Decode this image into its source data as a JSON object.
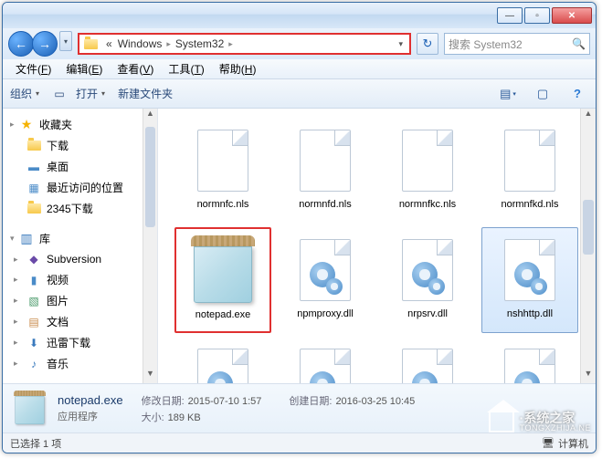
{
  "titlebar": {
    "min": "—",
    "max": "▫",
    "close": "✕"
  },
  "nav": {
    "back": "←",
    "forward": "→",
    "drop": "▾",
    "refresh": "↻"
  },
  "address": {
    "prefix": "«",
    "crumbs": [
      "Windows",
      "System32"
    ],
    "sep": "▸",
    "drop": "▾"
  },
  "search": {
    "placeholder": "搜索 System32",
    "icon": "🔍"
  },
  "menu": [
    {
      "label": "文件",
      "hot": "F"
    },
    {
      "label": "编辑",
      "hot": "E"
    },
    {
      "label": "查看",
      "hot": "V"
    },
    {
      "label": "工具",
      "hot": "T"
    },
    {
      "label": "帮助",
      "hot": "H"
    }
  ],
  "toolbar": {
    "organize": "组织",
    "open": "打开",
    "newfolder": "新建文件夹",
    "drop": "▾",
    "viewicon": "▤",
    "helpicon": "?"
  },
  "sidebar": {
    "favorites": {
      "label": "收藏夹",
      "items": [
        "下载",
        "桌面",
        "最近访问的位置",
        "2345下载"
      ]
    },
    "libraries": {
      "label": "库",
      "items": [
        "Subversion",
        "视频",
        "图片",
        "文档",
        "迅雷下载",
        "音乐"
      ]
    }
  },
  "files": [
    {
      "name": "normnfc.nls",
      "type": "doc",
      "selected": false,
      "highlighted": false
    },
    {
      "name": "normnfd.nls",
      "type": "doc",
      "selected": false,
      "highlighted": false
    },
    {
      "name": "normnfkc.nls",
      "type": "doc",
      "selected": false,
      "highlighted": false
    },
    {
      "name": "normnfkd.nls",
      "type": "doc",
      "selected": false,
      "highlighted": false
    },
    {
      "name": "notepad.exe",
      "type": "notepad",
      "selected": false,
      "highlighted": true
    },
    {
      "name": "npmproxy.dll",
      "type": "dll",
      "selected": false,
      "highlighted": false
    },
    {
      "name": "nrpsrv.dll",
      "type": "dll",
      "selected": false,
      "highlighted": false
    },
    {
      "name": "nshhttp.dll",
      "type": "dll",
      "selected": true,
      "highlighted": false
    },
    {
      "name": "",
      "type": "dll",
      "selected": false,
      "highlighted": false
    },
    {
      "name": "",
      "type": "dll",
      "selected": false,
      "highlighted": false
    },
    {
      "name": "",
      "type": "dll",
      "selected": false,
      "highlighted": false
    },
    {
      "name": "",
      "type": "dll",
      "selected": false,
      "highlighted": false
    }
  ],
  "details": {
    "name": "notepad.exe",
    "type": "应用程序",
    "mod_label": "修改日期:",
    "mod_value": "2015-07-10 1:57",
    "create_label": "创建日期:",
    "create_value": "2016-03-25 10:45",
    "size_label": "大小:",
    "size_value": "189 KB"
  },
  "status": {
    "left": "已选择 1 项",
    "right_label": "计算机",
    "right_icon": "🖥"
  },
  "watermark": {
    "l1": "·系统之家",
    "l2": "TONGXZHIJA.NE"
  }
}
